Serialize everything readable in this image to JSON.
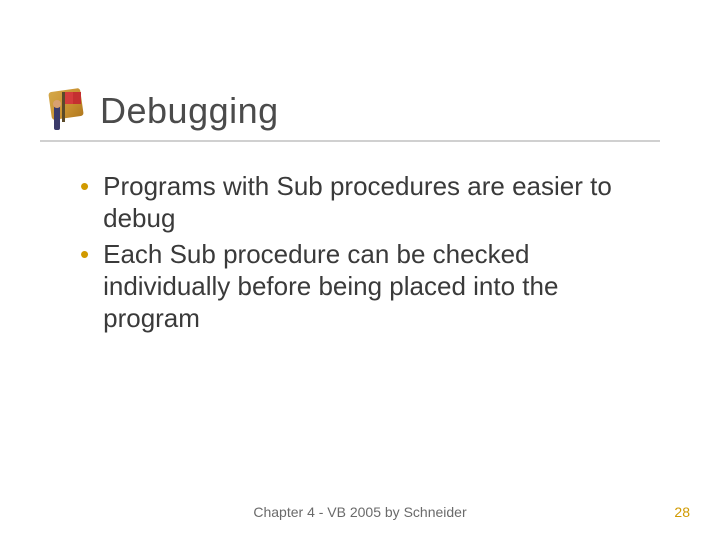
{
  "title": "Debugging",
  "bullets": [
    "Programs with Sub procedures are easier to debug",
    "Each Sub procedure can be checked individually before being placed into the program"
  ],
  "footer": "Chapter 4 - VB 2005 by Schneider",
  "page_number": "28"
}
